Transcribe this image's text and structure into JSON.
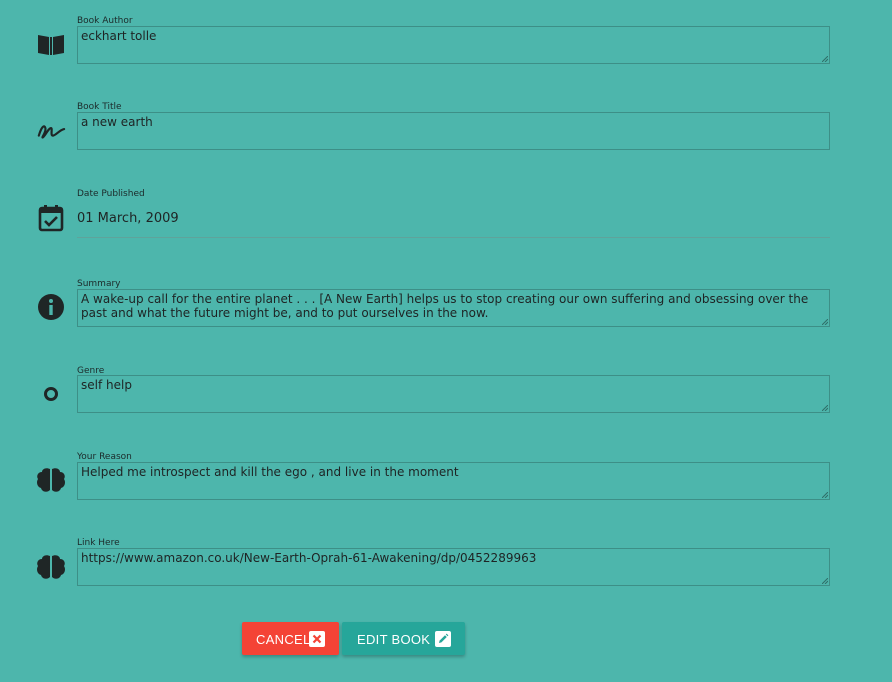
{
  "form": {
    "fields": [
      {
        "label": "Book Author",
        "value": "eckhart tolle",
        "icon": "book-icon"
      },
      {
        "label": "Book Title",
        "value": "a new earth",
        "icon": "signature-icon"
      },
      {
        "label": "Date Published",
        "value": "01 March, 2009",
        "icon": "calendar-check-icon"
      },
      {
        "label": "Summary",
        "value": "A wake-up call for the entire planet . . . [A New Earth] helps us to stop creating our own suffering and obsessing over the past and what the future might be, and to put ourselves in the now.",
        "icon": "info-icon"
      },
      {
        "label": "Genre",
        "value": "self help",
        "icon": "circle-icon"
      },
      {
        "label": "Your Reason",
        "value": "Helped me introspect and kill the ego , and live in the moment",
        "icon": "brain-icon"
      },
      {
        "label": "Link Here",
        "value": "https://www.amazon.co.uk/New-Earth-Oprah-61-Awakening/dp/0452289963",
        "icon": "brain-icon"
      }
    ]
  },
  "actions": {
    "cancel_label": "CANCEL",
    "edit_label": "EDIT BOOK"
  },
  "colors": {
    "background": "#4db6ac",
    "cancel": "#f44336",
    "edit": "#26a69a"
  }
}
